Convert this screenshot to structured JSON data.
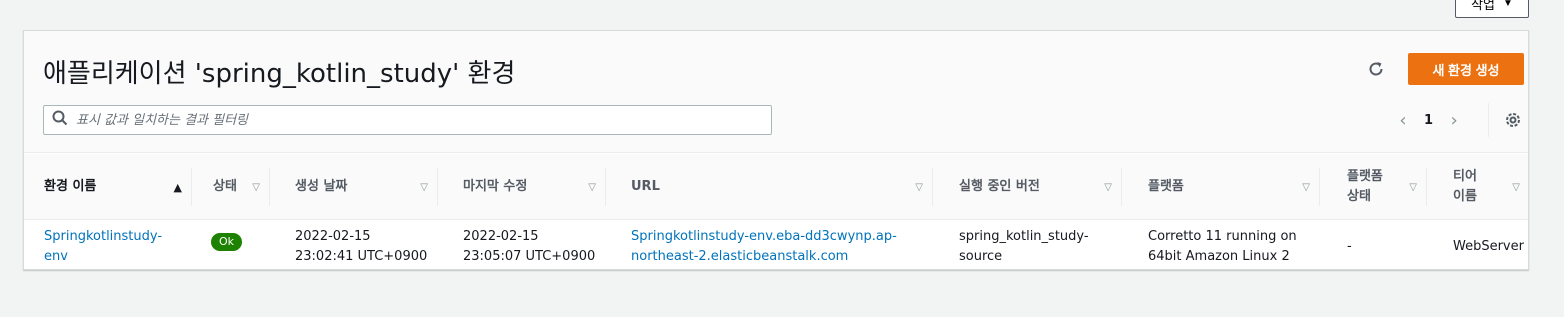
{
  "top_action": {
    "label": "작업",
    "caret": "▼"
  },
  "title": "애플리케이션 'spring_kotlin_study' 환경",
  "create_button": "새 환경 생성",
  "search": {
    "placeholder": "표시 값과 일치하는 결과 필터링"
  },
  "pager": {
    "prev": "‹",
    "page": "1",
    "next": "›"
  },
  "colors": {
    "accent": "#ec7211",
    "link": "#0073bb",
    "ok": "#1d8102"
  },
  "icons": {
    "refresh": "refresh-icon",
    "search": "search-icon",
    "settings": "gear-icon"
  },
  "columns": [
    {
      "label": "환경 이름",
      "sort": "▲"
    },
    {
      "label": "상태",
      "sort": "▽"
    },
    {
      "label": "생성 날짜",
      "sort": "▽"
    },
    {
      "label": "마지막 수정",
      "sort": "▽"
    },
    {
      "label": "URL",
      "sort": "▽"
    },
    {
      "label": "실행 중인 버전",
      "sort": "▽"
    },
    {
      "label": "플랫폼",
      "sort": "▽"
    },
    {
      "label": "플랫폼 상태",
      "sort": "▽"
    },
    {
      "label": "티어 이름",
      "sort": "▽"
    }
  ],
  "rows": [
    {
      "name": "Springkotlinstudy-env",
      "status": "Ok",
      "created_date": "2022-02-15",
      "created_time": "23:02:41 UTC+0900",
      "modified_date": "2022-02-15",
      "modified_time": "23:05:07 UTC+0900",
      "url_line1": "Springkotlinstudy-env.eba-dd3cwynp.ap-",
      "url_line2": "northeast-2.elasticbeanstalk.com",
      "version_line1": "spring_kotlin_study-",
      "version_line2": "source",
      "platform_line1": "Corretto 11 running on",
      "platform_line2": "64bit Amazon Linux 2",
      "platform_status": "-",
      "tier": "WebServer"
    }
  ]
}
